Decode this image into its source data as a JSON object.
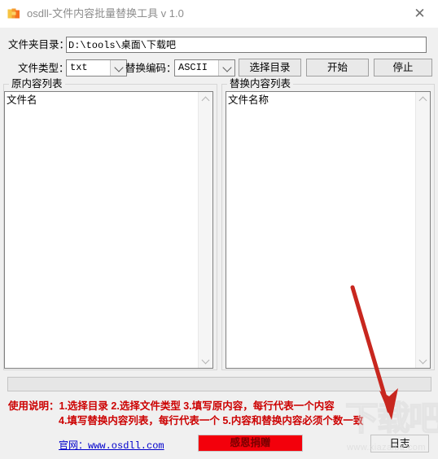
{
  "window": {
    "title": "osdll-文件内容批量替换工具 v 1.0",
    "icon": "folder-icon",
    "close_label": "✕"
  },
  "form": {
    "dir_label": "文件夹目录：",
    "dir_value": "D:\\tools\\桌面\\下载吧",
    "dir_placeholder": "",
    "type_label": "文件类型：",
    "type_value": "txt",
    "encoding_label": "替换编码：",
    "encoding_value": "ASCII",
    "buttons": {
      "choose_dir": "选择目录",
      "start": "开始",
      "stop": "停止"
    }
  },
  "panels": {
    "left": {
      "group_title": "原内容列表",
      "list_header": "文件名",
      "rows": []
    },
    "right": {
      "group_title": "替换内容列表",
      "list_header": "文件名称",
      "rows": []
    }
  },
  "progress": {
    "value": 0
  },
  "footer": {
    "instructions_line1": "使用说明：1.选择目录  2.选择文件类型  3.填写原内容，每行代表一个内容",
    "instructions_line2": "4.填写替换内容列表，每行代表一个  5.内容和替换内容必须个数一致",
    "site_link": "官网：www.osdll.com",
    "donate_label": "感恩捐赠",
    "log_label": "日志"
  },
  "watermark": {
    "main": "下载吧",
    "sub": "www.xiazaiba.com"
  },
  "colors": {
    "accent_red": "#cc0000",
    "donate_red": "#f3000b",
    "link_blue": "#0000cc",
    "window_bg": "#f0f0f0",
    "titlebar_bg": "#ffffff",
    "arrow_red": "#c8271f"
  }
}
